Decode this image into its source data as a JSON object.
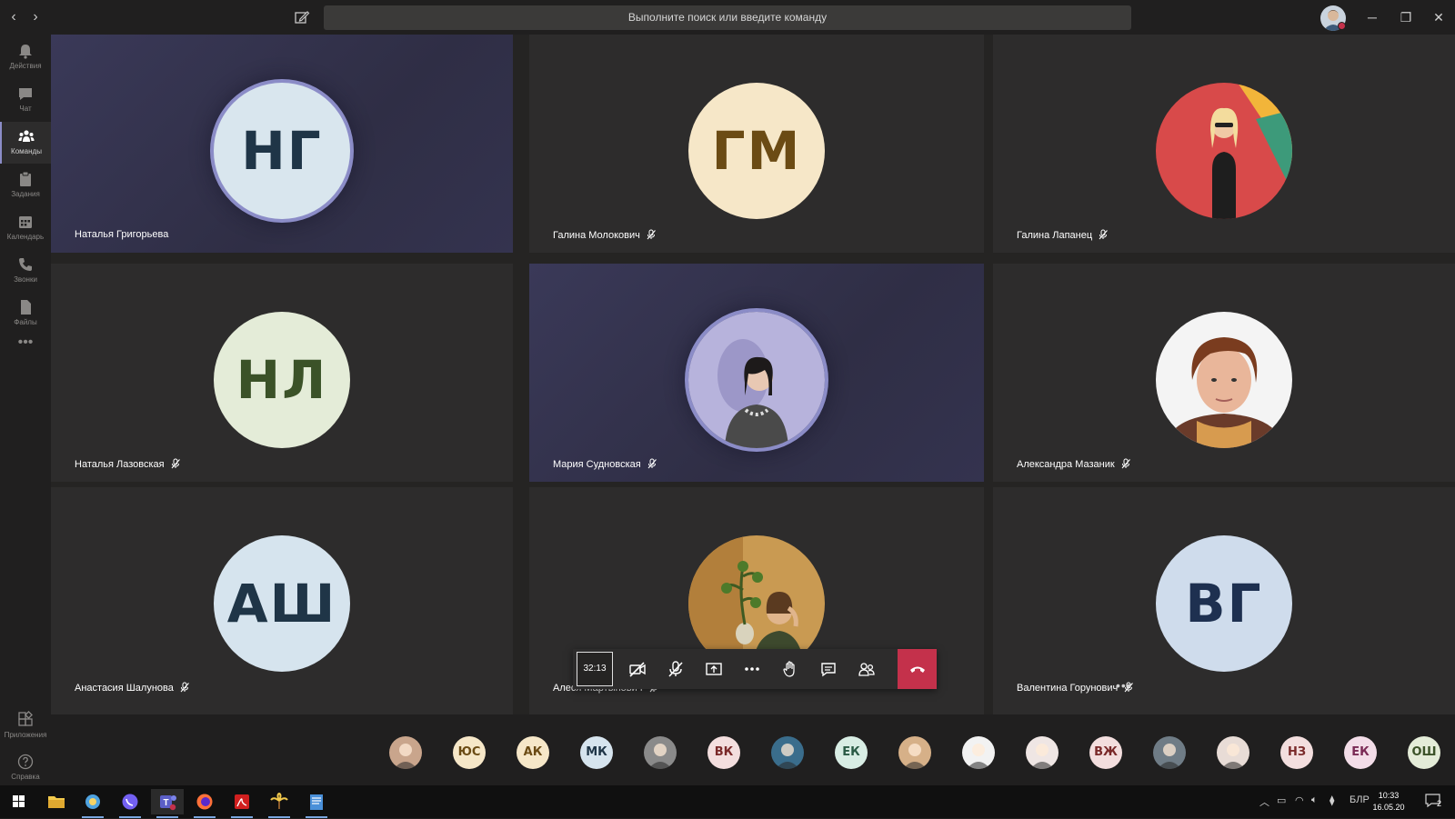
{
  "titlebar": {
    "search_placeholder": "Выполните поиск или введите команду"
  },
  "rail": [
    {
      "label": "Действия",
      "icon": "bell-icon",
      "active": false
    },
    {
      "label": "Чат",
      "icon": "chat-icon",
      "active": false
    },
    {
      "label": "Команды",
      "icon": "teams-icon",
      "active": true
    },
    {
      "label": "Задания",
      "icon": "assignments-icon",
      "active": false
    },
    {
      "label": "Календарь",
      "icon": "calendar-icon",
      "active": false
    },
    {
      "label": "Звонки",
      "icon": "phone-icon",
      "active": false
    },
    {
      "label": "Файлы",
      "icon": "files-icon",
      "active": false
    }
  ],
  "rail_bottom": [
    {
      "label": "Приложения",
      "icon": "apps-icon"
    },
    {
      "label": "Справка",
      "icon": "help-icon"
    }
  ],
  "tiles": [
    {
      "name": "Наталья Григорьева",
      "initials": "НГ",
      "bg": "#d9e6ee",
      "fg": "#1f3547",
      "speaking": true,
      "muted": false
    },
    {
      "name": "Галина Молокович",
      "initials": "ГМ",
      "bg": "#f6e7c8",
      "fg": "#6b4b14",
      "speaking": false,
      "muted": true
    },
    {
      "name": "Галина Лапанец",
      "initials": "",
      "photo": "photo-red-yellow",
      "speaking": false,
      "muted": true
    },
    {
      "name": "Наталья Лазовская",
      "initials": "НЛ",
      "bg": "#e4ecd8",
      "fg": "#3b5228",
      "speaking": false,
      "muted": true
    },
    {
      "name": "Мария Судновская",
      "initials": "",
      "photo": "photo-lilac",
      "speaking": true,
      "muted": true
    },
    {
      "name": "Александра Мазаник",
      "initials": "",
      "photo": "photo-portrait",
      "speaking": false,
      "muted": true
    },
    {
      "name": "Анастасия Шалунова",
      "initials": "АШ",
      "bg": "#d6e4ee",
      "fg": "#1f3547",
      "speaking": false,
      "muted": true
    },
    {
      "name": "Алеся Мартынович",
      "initials": "",
      "photo": "photo-amber",
      "speaking": false,
      "muted": true
    },
    {
      "name": "Валентина Горунович",
      "initials": "ВГ",
      "bg": "#cfdcec",
      "fg": "#1e3050",
      "speaking": false,
      "muted": true,
      "more": true
    }
  ],
  "controls": {
    "timer": "32:13",
    "buttons": [
      "camera-off-icon",
      "mic-off-icon",
      "share-screen-icon",
      "more-icon",
      "raise-hand-icon",
      "chat-icon",
      "participants-icon"
    ]
  },
  "strip": [
    {
      "initials": "",
      "bg": "#c9a58c"
    },
    {
      "initials": "ЮС",
      "bg": "#f6e7c8",
      "fg": "#6b4b14"
    },
    {
      "initials": "АК",
      "bg": "#f6e7c8",
      "fg": "#6b4b14"
    },
    {
      "initials": "МК",
      "bg": "#d6e4ee",
      "fg": "#1f3547"
    },
    {
      "initials": "",
      "bg": "#8a8a8a"
    },
    {
      "initials": "ВК",
      "bg": "#f3dede",
      "fg": "#7a2a2a"
    },
    {
      "initials": "",
      "bg": "#3a6d8c"
    },
    {
      "initials": "ЕК",
      "bg": "#d8ede4",
      "fg": "#2a5a45"
    },
    {
      "initials": "",
      "bg": "#d6b088"
    },
    {
      "initials": "",
      "bg": "#f2f2f2"
    },
    {
      "initials": "",
      "bg": "#efe6e4"
    },
    {
      "initials": "ВЖ",
      "bg": "#f3dede",
      "fg": "#7a2a2a"
    },
    {
      "initials": "",
      "bg": "#6f7c86"
    },
    {
      "initials": "",
      "bg": "#e8dcd6"
    },
    {
      "initials": "НЗ",
      "bg": "#f3dede",
      "fg": "#7a2a2a"
    },
    {
      "initials": "ЕК",
      "bg": "#f3dde8",
      "fg": "#7a2a55"
    },
    {
      "initials": "ОШ",
      "bg": "#e4ecd8",
      "fg": "#3b5228"
    }
  ],
  "taskbar": {
    "apps": [
      "windows-start-icon",
      "file-explorer-icon",
      "browser-icon",
      "viber-icon",
      "teams-icon",
      "firefox-icon",
      "pdf-icon",
      "palm-icon",
      "document-icon"
    ],
    "lang": "БЛР",
    "time": "10:33",
    "date": "16.05.20",
    "notifications": "2"
  }
}
